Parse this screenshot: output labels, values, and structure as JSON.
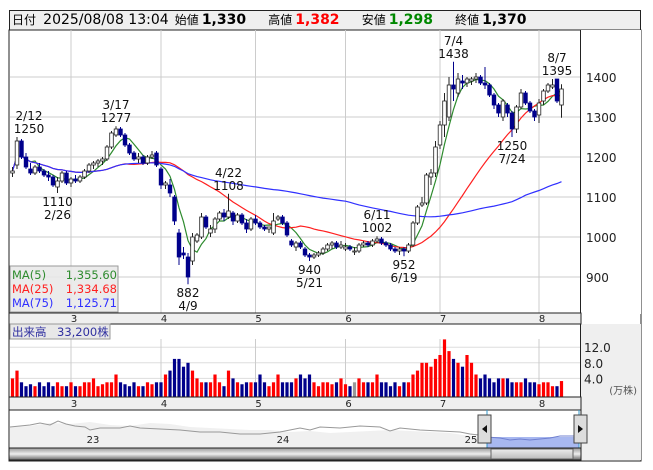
{
  "header": {
    "date_label": "日付",
    "datetime": "2025/08/08 13:04",
    "open_label": "始値",
    "open": "1,330",
    "high_label": "高値",
    "high": "1,382",
    "low_label": "安値",
    "low": "1,298",
    "close_label": "終値",
    "close": "1,370"
  },
  "legend": {
    "ma5_label": "MA(5)",
    "ma5": "1,355.60",
    "ma25_label": "MA(25)",
    "ma25": "1,334.68",
    "ma75_label": "MA(75)",
    "ma75": "1,125.71"
  },
  "volume_header": {
    "label": "出来高",
    "value": "33,200株"
  },
  "volume_unit": "(万株)",
  "navigator": {
    "years": [
      "23",
      "24",
      "25"
    ]
  },
  "colors": {
    "up_volume": "#ff0000",
    "down": "#00008b",
    "ma5": "#2e8b2e",
    "ma25": "#ff2020",
    "ma75": "#3030ff",
    "flat_volume": "#999999",
    "nav_fill": "#a8b8f0"
  },
  "chart_data": {
    "type": "candlestick",
    "price_axis": {
      "ticks": [
        "1400",
        "1300",
        "1200",
        "1100",
        "1000",
        "900"
      ],
      "ylim": [
        840,
        1480
      ]
    },
    "volume_axis": {
      "ticks": [
        "12.0",
        "8.0",
        "4.0"
      ],
      "unit": "万株"
    },
    "month_labels": [
      {
        "label": "3",
        "index": 13
      },
      {
        "label": "4",
        "index": 33
      },
      {
        "label": "5",
        "index": 54
      },
      {
        "label": "6",
        "index": 74
      },
      {
        "label": "7",
        "index": 95
      },
      {
        "label": "8",
        "index": 117
      }
    ],
    "annotations": [
      {
        "date": "2/12",
        "value": "1250",
        "index": 1,
        "price": 1250,
        "side": "above-left"
      },
      {
        "date": "2/26",
        "value": "1110",
        "index": 10,
        "price": 1110,
        "side": "below"
      },
      {
        "date": "3/17",
        "value": "1277",
        "index": 23,
        "price": 1277,
        "side": "above"
      },
      {
        "date": "4/9",
        "value": "882",
        "index": 39,
        "price": 882,
        "side": "below"
      },
      {
        "date": "4/22",
        "value": "1108",
        "index": 48,
        "price": 1108,
        "side": "above"
      },
      {
        "date": "5/21",
        "value": "940",
        "index": 66,
        "price": 940,
        "side": "below"
      },
      {
        "date": "6/11",
        "value": "1002",
        "index": 81,
        "price": 1002,
        "side": "above"
      },
      {
        "date": "6/19",
        "value": "952",
        "index": 87,
        "price": 952,
        "side": "below"
      },
      {
        "date": "7/4",
        "value": "1438",
        "index": 98,
        "price": 1438,
        "side": "above"
      },
      {
        "date": "7/24",
        "value": "1250",
        "index": 111,
        "price": 1250,
        "side": "below"
      },
      {
        "date": "8/7",
        "value": "1395",
        "index": 121,
        "price": 1395,
        "side": "above"
      }
    ],
    "ma_periods": [
      5,
      25,
      75
    ],
    "ohlc": [
      [
        1160,
        1175,
        1150,
        1165
      ],
      [
        1180,
        1250,
        1170,
        1240
      ],
      [
        1240,
        1245,
        1195,
        1200
      ],
      [
        1200,
        1210,
        1170,
        1175
      ],
      [
        1170,
        1185,
        1155,
        1160
      ],
      [
        1160,
        1180,
        1155,
        1175
      ],
      [
        1175,
        1185,
        1160,
        1165
      ],
      [
        1165,
        1170,
        1150,
        1155
      ],
      [
        1155,
        1165,
        1140,
        1150
      ],
      [
        1150,
        1155,
        1125,
        1130
      ],
      [
        1125,
        1150,
        1110,
        1140
      ],
      [
        1140,
        1165,
        1135,
        1160
      ],
      [
        1160,
        1165,
        1130,
        1135
      ],
      [
        1135,
        1150,
        1125,
        1145
      ],
      [
        1145,
        1155,
        1135,
        1140
      ],
      [
        1140,
        1155,
        1135,
        1150
      ],
      [
        1150,
        1170,
        1145,
        1165
      ],
      [
        1165,
        1185,
        1160,
        1180
      ],
      [
        1180,
        1190,
        1170,
        1185
      ],
      [
        1185,
        1195,
        1175,
        1190
      ],
      [
        1190,
        1200,
        1180,
        1195
      ],
      [
        1195,
        1230,
        1190,
        1225
      ],
      [
        1225,
        1265,
        1220,
        1260
      ],
      [
        1255,
        1277,
        1250,
        1270
      ],
      [
        1270,
        1275,
        1250,
        1255
      ],
      [
        1255,
        1260,
        1225,
        1230
      ],
      [
        1230,
        1235,
        1205,
        1210
      ],
      [
        1210,
        1215,
        1190,
        1195
      ],
      [
        1195,
        1210,
        1185,
        1200
      ],
      [
        1200,
        1205,
        1180,
        1185
      ],
      [
        1185,
        1205,
        1180,
        1200
      ],
      [
        1200,
        1215,
        1195,
        1205
      ],
      [
        1210,
        1215,
        1175,
        1180
      ],
      [
        1170,
        1175,
        1120,
        1130
      ],
      [
        1130,
        1140,
        1120,
        1135
      ],
      [
        1130,
        1145,
        1100,
        1110
      ],
      [
        1100,
        1105,
        1030,
        1040
      ],
      [
        1010,
        1020,
        930,
        950
      ],
      [
        960,
        975,
        945,
        955
      ],
      [
        950,
        960,
        882,
        900
      ],
      [
        940,
        1010,
        930,
        1000
      ],
      [
        990,
        1010,
        985,
        1005
      ],
      [
        1000,
        1060,
        995,
        1050
      ],
      [
        1050,
        1055,
        1020,
        1025
      ],
      [
        1010,
        1030,
        1000,
        1020
      ],
      [
        1020,
        1050,
        1010,
        1045
      ],
      [
        1045,
        1065,
        1040,
        1060
      ],
      [
        1060,
        1070,
        1040,
        1050
      ],
      [
        1050,
        1108,
        1045,
        1065
      ],
      [
        1060,
        1065,
        1030,
        1040
      ],
      [
        1040,
        1060,
        1035,
        1055
      ],
      [
        1055,
        1060,
        1030,
        1035
      ],
      [
        1035,
        1045,
        1010,
        1020
      ],
      [
        1020,
        1050,
        1015,
        1045
      ],
      [
        1045,
        1055,
        1030,
        1035
      ],
      [
        1035,
        1040,
        1020,
        1025
      ],
      [
        1025,
        1030,
        1015,
        1020
      ],
      [
        1020,
        1025,
        1010,
        1025
      ],
      [
        1010,
        1060,
        1005,
        1040
      ],
      [
        1045,
        1055,
        1040,
        1050
      ],
      [
        1050,
        1055,
        1030,
        1035
      ],
      [
        1035,
        1040,
        1000,
        1005
      ],
      [
        990,
        995,
        975,
        980
      ],
      [
        975,
        990,
        965,
        985
      ],
      [
        985,
        990,
        970,
        975
      ],
      [
        970,
        975,
        950,
        955
      ],
      [
        955,
        960,
        940,
        950
      ],
      [
        950,
        960,
        945,
        955
      ],
      [
        955,
        965,
        950,
        960
      ],
      [
        960,
        975,
        955,
        970
      ],
      [
        970,
        985,
        965,
        980
      ],
      [
        980,
        990,
        970,
        985
      ],
      [
        985,
        990,
        970,
        975
      ],
      [
        975,
        990,
        970,
        980
      ],
      [
        970,
        985,
        965,
        975
      ],
      [
        975,
        980,
        965,
        970
      ],
      [
        965,
        975,
        955,
        965
      ],
      [
        965,
        985,
        960,
        980
      ],
      [
        980,
        990,
        975,
        985
      ],
      [
        985,
        990,
        975,
        980
      ],
      [
        980,
        995,
        975,
        990
      ],
      [
        990,
        1002,
        985,
        995
      ],
      [
        995,
        1000,
        980,
        985
      ],
      [
        985,
        990,
        975,
        980
      ],
      [
        980,
        985,
        965,
        970
      ],
      [
        970,
        975,
        960,
        965
      ],
      [
        965,
        975,
        955,
        970
      ],
      [
        970,
        975,
        952,
        965
      ],
      [
        965,
        985,
        960,
        980
      ],
      [
        980,
        1040,
        975,
        1035
      ],
      [
        1035,
        1080,
        1030,
        1075
      ],
      [
        1080,
        1100,
        1075,
        1085
      ],
      [
        1085,
        1160,
        1080,
        1155
      ],
      [
        1150,
        1170,
        1130,
        1160
      ],
      [
        1160,
        1240,
        1150,
        1225
      ],
      [
        1230,
        1290,
        1220,
        1280
      ],
      [
        1280,
        1360,
        1250,
        1340
      ],
      [
        1300,
        1400,
        1290,
        1380
      ],
      [
        1380,
        1438,
        1340,
        1370
      ],
      [
        1360,
        1410,
        1350,
        1395
      ],
      [
        1390,
        1405,
        1370,
        1385
      ],
      [
        1385,
        1400,
        1375,
        1395
      ],
      [
        1390,
        1400,
        1380,
        1395
      ],
      [
        1395,
        1410,
        1385,
        1400
      ],
      [
        1400,
        1405,
        1380,
        1385
      ],
      [
        1385,
        1425,
        1370,
        1380
      ],
      [
        1380,
        1385,
        1350,
        1355
      ],
      [
        1355,
        1360,
        1320,
        1330
      ],
      [
        1330,
        1335,
        1300,
        1310
      ],
      [
        1300,
        1345,
        1290,
        1340
      ],
      [
        1330,
        1335,
        1300,
        1310
      ],
      [
        1310,
        1315,
        1250,
        1270
      ],
      [
        1270,
        1330,
        1260,
        1325
      ],
      [
        1325,
        1370,
        1320,
        1360
      ],
      [
        1360,
        1365,
        1330,
        1335
      ],
      [
        1335,
        1340,
        1310,
        1315
      ],
      [
        1315,
        1320,
        1290,
        1300
      ],
      [
        1305,
        1345,
        1285,
        1335
      ],
      [
        1340,
        1370,
        1330,
        1365
      ],
      [
        1365,
        1385,
        1360,
        1380
      ],
      [
        1375,
        1395,
        1370,
        1380
      ],
      [
        1395,
        1395,
        1335,
        1340
      ],
      [
        1330,
        1382,
        1298,
        1370
      ]
    ],
    "volume": [
      4,
      6,
      3,
      2,
      2.5,
      2,
      3,
      2,
      3,
      2,
      3,
      2,
      2,
      3,
      2,
      2,
      3,
      3,
      4,
      2,
      2.5,
      3,
      3,
      5,
      3,
      2.5,
      2,
      3,
      2,
      2,
      3,
      2.5,
      3,
      3,
      5,
      6,
      9,
      9,
      7,
      8,
      6,
      4,
      3,
      3,
      3,
      5,
      3,
      2,
      6,
      4,
      3,
      2.5,
      3,
      3,
      3,
      5,
      3,
      2,
      3,
      5,
      3,
      3,
      3,
      4,
      5,
      4,
      5,
      3,
      2,
      3,
      3,
      2.5,
      3,
      4,
      2.5,
      2,
      3,
      4,
      3,
      3,
      3,
      5,
      3,
      3,
      2,
      3,
      2,
      3,
      3,
      5,
      6,
      8,
      8,
      7,
      9,
      10,
      14,
      11,
      9,
      8,
      7,
      10,
      8,
      5,
      4,
      5,
      4,
      3,
      4,
      4,
      4,
      3,
      3,
      3,
      4,
      3,
      3,
      2.5,
      3,
      3,
      2,
      2,
      3.32
    ]
  }
}
